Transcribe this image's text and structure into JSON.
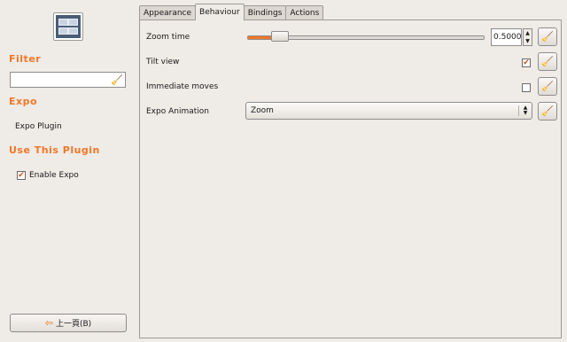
{
  "sidebar": {
    "plugin_icon": "expo-plugin-icon",
    "filter_title": "Filter",
    "filter_value": "",
    "plugin_section_title": "Expo",
    "plugin_name": "Expo Plugin",
    "use_section_title": "Use This Plugin",
    "enable_label": "Enable Expo",
    "enable_checked": true,
    "back_button_label": "上一頁(B)"
  },
  "tabs": [
    {
      "label": "Appearance",
      "active": false
    },
    {
      "label": "Behaviour",
      "active": true
    },
    {
      "label": "Bindings",
      "active": false
    },
    {
      "label": "Actions",
      "active": false
    }
  ],
  "settings": {
    "zoom_time": {
      "label": "Zoom time",
      "value": "0.5000",
      "slider_fraction": 0.1
    },
    "tilt_view": {
      "label": "Tilt view",
      "checked": true
    },
    "immediate_moves": {
      "label": "Immediate moves",
      "checked": false
    },
    "expo_animation": {
      "label": "Expo Animation",
      "selected": "Zoom"
    }
  },
  "colors": {
    "accent": "#f07727",
    "background": "#efebe7"
  },
  "icons": {
    "reset": "broom-icon",
    "clear": "broom-icon",
    "back": "left-arrow-icon"
  }
}
